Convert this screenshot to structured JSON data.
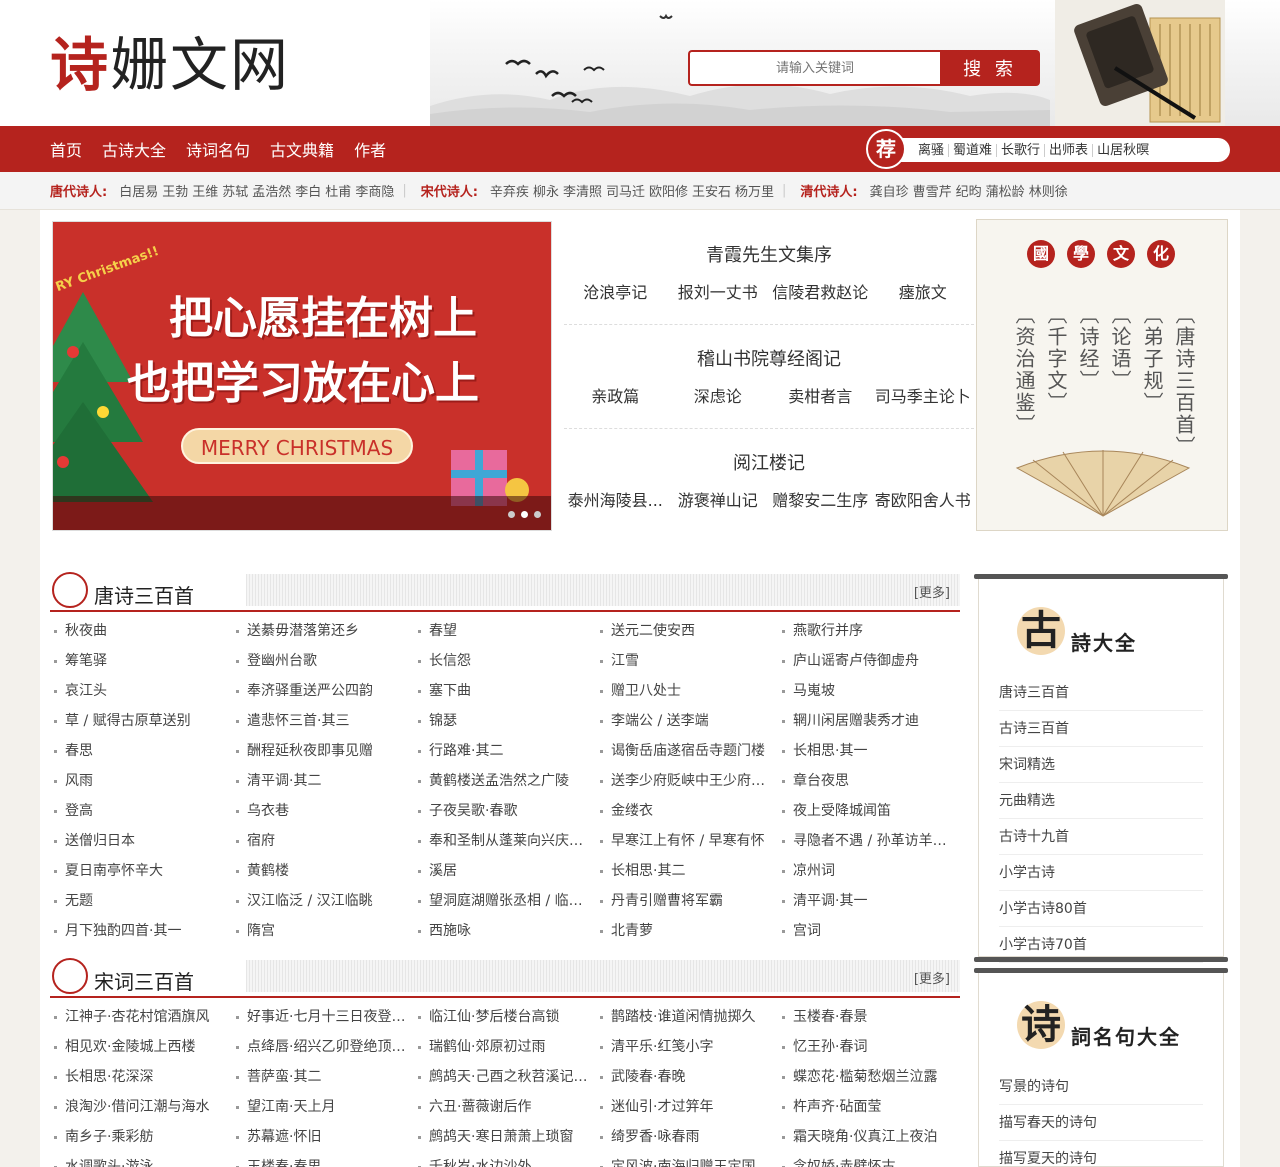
{
  "site": {
    "logo_char1": "诗",
    "logo_rest": "姗文网"
  },
  "search": {
    "placeholder": "请输入关键词",
    "button": "搜 索"
  },
  "nav": {
    "items": [
      "首页",
      "古诗大全",
      "诗词名句",
      "古文典籍",
      "作者"
    ]
  },
  "recommend": {
    "seal": "荐",
    "items": [
      "离骚",
      "蜀道难",
      "长歌行",
      "出师表",
      "山居秋暝"
    ]
  },
  "poets": [
    {
      "label": "唐代诗人:",
      "names": [
        "白居易",
        "王勃",
        "王维",
        "苏轼",
        "孟浩然",
        "李白",
        "杜甫",
        "李商隐"
      ]
    },
    {
      "label": "宋代诗人:",
      "names": [
        "辛弃疾",
        "柳永",
        "李清照",
        "司马迁",
        "欧阳修",
        "王安石",
        "杨万里"
      ]
    },
    {
      "label": "清代诗人:",
      "names": [
        "龚自珍",
        "曹雪芹",
        "纪昀",
        "蒲松龄",
        "林则徐"
      ]
    }
  ],
  "banner": {
    "line1": "把心愿挂在树上",
    "line2": "也把学习放在心上",
    "pill": "MERRY CHRISTMAS",
    "corner": "RY Christmas!!"
  },
  "featured": [
    {
      "title": "青霞先生文集序",
      "items": [
        "沧浪亭记",
        "报刘一丈书",
        "信陵君救赵论",
        "瘗旅文"
      ]
    },
    {
      "title": "稽山书院尊经阁记",
      "items": [
        "亲政篇",
        "深虑论",
        "卖柑者言",
        "司马季主论卜"
      ]
    },
    {
      "title": "阅江楼记",
      "items": [
        "泰州海陵县...",
        "游褒禅山记",
        "赠黎安二生序",
        "寄欧阳舍人书"
      ]
    }
  ],
  "guoxue": {
    "seals": [
      "國",
      "學",
      "文",
      "化"
    ],
    "columns": [
      "〔唐诗三百首〕",
      "〔弟子规〕",
      "〔论语〕",
      "〔诗经〕",
      "〔千字文〕",
      "〔资治通鉴〕"
    ]
  },
  "tang": {
    "title": "唐诗三百首",
    "more": "[更多]",
    "items": [
      "秋夜曲",
      "送綦毋潜落第还乡",
      "春望",
      "送元二使安西",
      "燕歌行并序",
      "筹笔驿",
      "登幽州台歌",
      "长信怨",
      "江雪",
      "庐山谣寄卢侍御虚舟",
      "哀江头",
      "奉济驿重送严公四韵",
      "塞下曲",
      "赠卫八处士",
      "马嵬坡",
      "草 / 赋得古原草送别",
      "遣悲怀三首·其三",
      "锦瑟",
      "李端公 / 送李端",
      "辋川闲居赠裴秀才迪",
      "春思",
      "酬程延秋夜即事见赠",
      "行路难·其二",
      "谒衡岳庙遂宿岳寺题门楼",
      "长相思·其一",
      "风雨",
      "清平调·其二",
      "黄鹤楼送孟浩然之广陵",
      "送李少府贬峡中王少府贬长沙",
      "章台夜思",
      "登高",
      "乌衣巷",
      "子夜吴歌·春歌",
      "金缕衣",
      "夜上受降城闻笛",
      "送僧归日本",
      "宿府",
      "奉和圣制从蓬莱向兴庆阁道中",
      "早寒江上有怀 / 早寒有怀",
      "寻隐者不遇 / 孙革访羊尊师",
      "夏日南亭怀辛大",
      "黄鹤楼",
      "溪居",
      "长相思·其二",
      "凉州词",
      "无题",
      "汉江临泛 / 汉江临眺",
      "望洞庭湖赠张丞相 / 临洞庭湖",
      "丹青引赠曹将军霸",
      "清平调·其一",
      "月下独酌四首·其一",
      "隋宫",
      "西施咏",
      "北青萝",
      "宫词"
    ]
  },
  "song": {
    "title": "宋词三百首",
    "more": "[更多]",
    "items": [
      "江神子·杏花村馆酒旗风",
      "好事近·七月十三日夜登万花川谷望月作",
      "临江仙·梦后楼台高锁",
      "鹊踏枝·谁道闲情抛掷久",
      "玉楼春·春景",
      "相见欢·金陵城上西楼",
      "点绛唇·绍兴乙卯登绝顶小亭",
      "瑞鹤仙·郊原初过雨",
      "清平乐·红笺小字",
      "忆王孙·春词",
      "长相思·花深深",
      "菩萨蛮·其二",
      "鹧鸪天·己酉之秋苕溪记所见",
      "武陵春·春晚",
      "蝶恋花·槛菊愁烟兰泣露",
      "浪淘沙·借问江潮与海水",
      "望江南·天上月",
      "六丑·蔷薇谢后作",
      "迷仙引·才过笄年",
      "杵声齐·砧面莹",
      "南乡子·乘彩舫",
      "苏幕遮·怀旧",
      "鹧鸪天·寒日萧萧上琐窗",
      "绮罗香·咏春雨",
      "霜天晓角·仪真江上夜泊",
      "水调歌头·游泳",
      "玉楼春·春思",
      "千秋岁·水边沙外",
      "定风波·南海归赠王定国侍人寓娘",
      "念奴娇·赤壁怀古"
    ]
  },
  "side_gushi": {
    "big": "古",
    "title": "詩大全",
    "items": [
      "唐诗三百首",
      "古诗三百首",
      "宋词精选",
      "元曲精选",
      "古诗十九首",
      "小学古诗",
      "小学古诗80首",
      "小学古诗70首"
    ]
  },
  "side_mingju": {
    "big": "诗",
    "title": "詞名句大全",
    "items": [
      "写景的诗句",
      "描写春天的诗句",
      "描写夏天的诗句"
    ]
  }
}
